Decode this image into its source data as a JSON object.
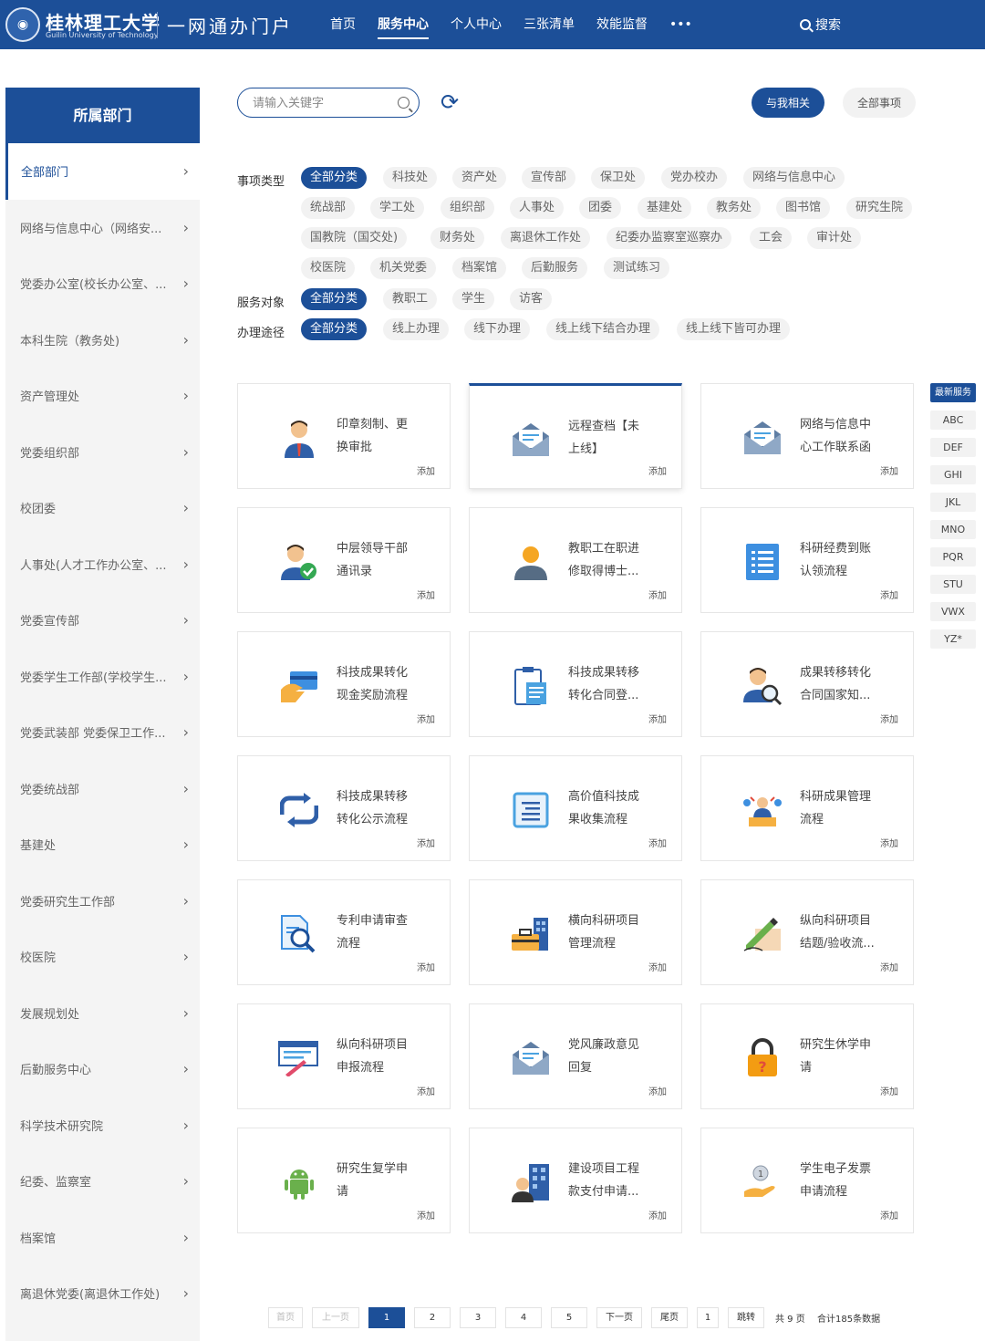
{
  "header": {
    "school_name": "桂林理工大学",
    "school_en": "Guilin University of Technology",
    "portal_title": "一网通办门户",
    "nav": [
      "首页",
      "服务中心",
      "个人中心",
      "三张清单",
      "效能监督",
      "•••"
    ],
    "search_label": "搜索",
    "accent": "#1c4f98"
  },
  "sidebar": {
    "title": "所属部门",
    "items": [
      "全部部门",
      "网络与信息中心（网络安...",
      "党委办公室(校长办公室、...",
      "本科生院（教务处)",
      "资产管理处",
      "党委组织部",
      "校团委",
      "人事处(人才工作办公室、...",
      "党委宣传部",
      "党委学生工作部(学校学生...",
      "党委武装部 党委保卫工作...",
      "党委统战部",
      "基建处",
      "党委研究生工作部",
      "校医院",
      "发展规划处",
      "后勤服务中心",
      "科学技术研究院",
      "纪委、监察室",
      "档案馆",
      "离退休党委(离退休工作处)"
    ]
  },
  "toolbar": {
    "search_placeholder": "请输入关键字",
    "related_btn": "与我相关",
    "all_btn": "全部事项"
  },
  "filters": {
    "type_label": "事项类型",
    "type_chips": [
      "全部分类",
      "科技处",
      "资产处",
      "宣传部",
      "保卫处",
      "党办校办",
      "网络与信息中心",
      "统战部",
      "学工处",
      "组织部",
      "人事处",
      "团委",
      "基建处",
      "教务处",
      "图书馆",
      "研究生院",
      "国教院（国交处)",
      "财务处",
      "离退休工作处",
      "纪委办监察室巡察办",
      "工会",
      "审计处",
      "校医院",
      "机关党委",
      "档案馆",
      "后勤服务",
      "测试练习"
    ],
    "audience_label": "服务对象",
    "audience_chips": [
      "全部分类",
      "教职工",
      "学生",
      "访客"
    ],
    "channel_label": "办理途径",
    "channel_chips": [
      "全部分类",
      "线上办理",
      "线下办理",
      "线上线下结合办理",
      "线上线下皆可办理"
    ]
  },
  "cards": [
    {
      "l1": "印章刻制、更",
      "l2": "换审批",
      "add": "添加",
      "icon": "person-icon"
    },
    {
      "l1": "远程查档【未",
      "l2": "上线】",
      "add": "添加",
      "icon": "mail-icon"
    },
    {
      "l1": "网络与信息中",
      "l2": "心工作联系函",
      "add": "添加",
      "icon": "mail-icon"
    },
    {
      "l1": "中层领导干部",
      "l2": "通讯录",
      "add": "添加",
      "icon": "person-check-icon"
    },
    {
      "l1": "教职工在职进",
      "l2": "修取得博士...",
      "add": "添加",
      "icon": "user-icon"
    },
    {
      "l1": "科研经费到账",
      "l2": "认领流程",
      "add": "添加",
      "icon": "list-icon"
    },
    {
      "l1": "科技成果转化",
      "l2": "现金奖励流程",
      "add": "添加",
      "icon": "card-payment-icon"
    },
    {
      "l1": "科技成果转移",
      "l2": "转化合同登...",
      "add": "添加",
      "icon": "clipboard-icon"
    },
    {
      "l1": "成果转移转化",
      "l2": "合同国家知...",
      "add": "添加",
      "icon": "person-search-icon"
    },
    {
      "l1": "科技成果转移",
      "l2": "转化公示流程",
      "add": "添加",
      "icon": "cycle-icon"
    },
    {
      "l1": "高价值科技成",
      "l2": "果收集流程",
      "add": "添加",
      "icon": "document-icon"
    },
    {
      "l1": "科研成果管理",
      "l2": "流程",
      "add": "添加",
      "icon": "team-desk-icon"
    },
    {
      "l1": "专利申请审查",
      "l2": "流程",
      "add": "添加",
      "icon": "file-search-icon"
    },
    {
      "l1": "横向科研项目",
      "l2": "管理流程",
      "add": "添加",
      "icon": "briefcase-icon"
    },
    {
      "l1": "纵向科研项目",
      "l2": "结题/验收流...",
      "add": "添加",
      "icon": "sign-pen-icon"
    },
    {
      "l1": "纵向科研项目",
      "l2": "申报流程",
      "add": "添加",
      "icon": "form-pen-icon"
    },
    {
      "l1": "党风廉政意见",
      "l2": "回复",
      "add": "添加",
      "icon": "mail-icon"
    },
    {
      "l1": "研究生休学申",
      "l2": "请",
      "add": "添加",
      "icon": "lock-icon"
    },
    {
      "l1": "研究生复学申",
      "l2": "请",
      "add": "添加",
      "icon": "android-icon"
    },
    {
      "l1": "建设项目工程",
      "l2": "款支付申请...",
      "add": "添加",
      "icon": "building-person-icon"
    },
    {
      "l1": "学生电子发票",
      "l2": "申请流程",
      "add": "添加",
      "icon": "coin-hand-icon"
    }
  ],
  "alpha_index": [
    "最新服务",
    "ABC",
    "DEF",
    "GHI",
    "JKL",
    "MNO",
    "PQR",
    "STU",
    "VWX",
    "YZ*"
  ],
  "pagination": {
    "first": "首页",
    "prev": "上一页",
    "pages": [
      "1",
      "2",
      "3",
      "4",
      "5"
    ],
    "next": "下一页",
    "last": "尾页",
    "jump_value": "1",
    "jump": "跳转",
    "total_pages": "共 9 页",
    "total_records": "合计185条数据"
  }
}
